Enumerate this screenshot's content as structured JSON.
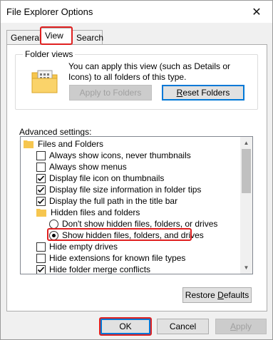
{
  "window": {
    "title": "File Explorer Options"
  },
  "tabs": [
    {
      "label": "General"
    },
    {
      "label": "View"
    },
    {
      "label": "Search"
    }
  ],
  "folder_views": {
    "legend": "Folder views",
    "description": "You can apply this view (such as Details or Icons) to all folders of this type.",
    "apply_button": "Apply to Folders",
    "reset_button_prefix": "",
    "reset_button_underline": "R",
    "reset_button_rest": "eset Folders"
  },
  "advanced": {
    "label": "Advanced settings:",
    "items": [
      {
        "type": "folder",
        "label": "Files and Folders"
      },
      {
        "type": "checkbox",
        "checked": false,
        "label": "Always show icons, never thumbnails"
      },
      {
        "type": "checkbox",
        "checked": false,
        "label": "Always show menus"
      },
      {
        "type": "checkbox",
        "checked": true,
        "label": "Display file icon on thumbnails"
      },
      {
        "type": "checkbox",
        "checked": true,
        "label": "Display file size information in folder tips"
      },
      {
        "type": "checkbox",
        "checked": true,
        "label": "Display the full path in the title bar"
      },
      {
        "type": "folder",
        "label": "Hidden files and folders"
      },
      {
        "type": "radio",
        "checked": false,
        "label": "Don't show hidden files, folders, or drives"
      },
      {
        "type": "radio",
        "checked": true,
        "label": "Show hidden files, folders, and drives"
      },
      {
        "type": "checkbox",
        "checked": false,
        "label": "Hide empty drives"
      },
      {
        "type": "checkbox",
        "checked": false,
        "label": "Hide extensions for known file types"
      },
      {
        "type": "checkbox",
        "checked": true,
        "label": "Hide folder merge conflicts"
      }
    ]
  },
  "restore_button": {
    "prefix": "Restore ",
    "underline": "D",
    "rest": "efaults"
  },
  "footer": {
    "ok": "OK",
    "cancel": "Cancel",
    "apply_prefix": "",
    "apply_underline": "A",
    "apply_rest": "pply"
  },
  "colors": {
    "highlight": "#e02020",
    "focus_border": "#0078d7"
  }
}
